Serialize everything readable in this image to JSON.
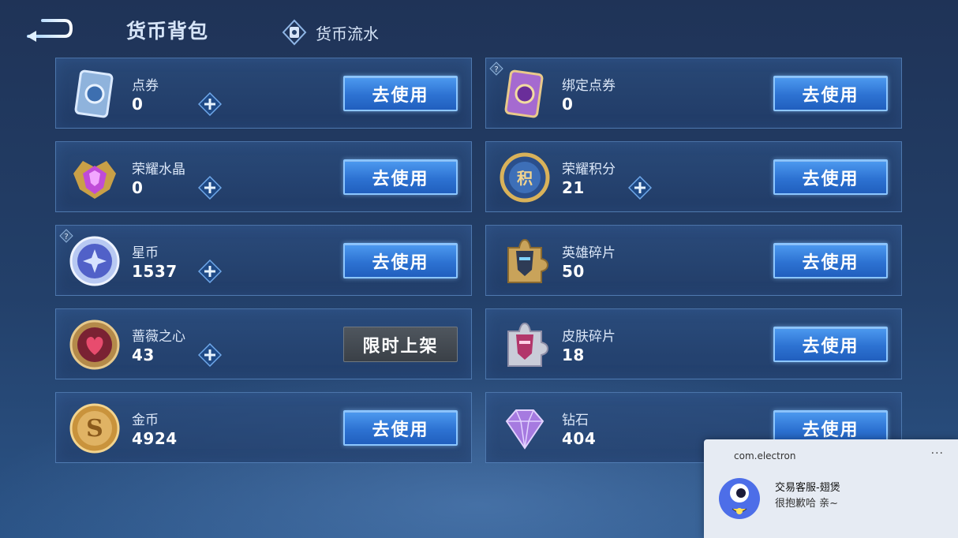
{
  "header": {
    "title": "货币背包",
    "flow_label": "货币流水"
  },
  "currencies_left": [
    {
      "name": "点券",
      "amount": "0",
      "action": "去使用",
      "icon": "ticket-icon"
    },
    {
      "name": "荣耀水晶",
      "amount": "0",
      "action": "去使用",
      "icon": "glory-crystal-icon"
    },
    {
      "name": "星币",
      "amount": "1537",
      "action": "去使用",
      "icon": "star-coin-icon"
    },
    {
      "name": "蔷薇之心",
      "amount": "43",
      "action": "限时上架",
      "icon": "rose-heart-icon"
    },
    {
      "name": "金币",
      "amount": "4924",
      "action": "去使用",
      "icon": "gold-coin-icon"
    }
  ],
  "currencies_right": [
    {
      "name": "绑定点券",
      "amount": "0",
      "action": "去使用",
      "icon": "bound-ticket-icon"
    },
    {
      "name": "荣耀积分",
      "amount": "21",
      "action": "去使用",
      "icon": "glory-points-icon"
    },
    {
      "name": "英雄碎片",
      "amount": "50",
      "action": "去使用",
      "icon": "hero-fragment-icon"
    },
    {
      "name": "皮肤碎片",
      "amount": "18",
      "action": "去使用",
      "icon": "skin-fragment-icon"
    },
    {
      "name": "钻石",
      "amount": "404",
      "action": "去使用",
      "icon": "diamond-icon"
    }
  ],
  "notification": {
    "app": "com.electron",
    "more": "···",
    "sender": "交易客服-翅煲",
    "message": "很抱歉哈 亲~"
  },
  "colors": {
    "accent": "#2d72d2",
    "accent_border": "#8cc6ff",
    "background": "#23406a"
  }
}
